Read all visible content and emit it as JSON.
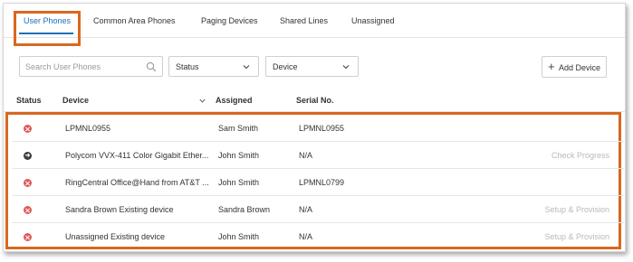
{
  "tabs": [
    {
      "label": "User Phones",
      "active": true
    },
    {
      "label": "Common Area Phones",
      "active": false
    },
    {
      "label": "Paging Devices",
      "active": false
    },
    {
      "label": "Shared Lines",
      "active": false
    },
    {
      "label": "Unassigned",
      "active": false
    }
  ],
  "toolbar": {
    "search_placeholder": "Search User Phones",
    "status_select": "Status",
    "device_select": "Device",
    "add_device_label": "Add Device"
  },
  "table": {
    "columns": [
      "Status",
      "Device",
      "Assigned",
      "Serial No."
    ],
    "rows": [
      {
        "status": "error",
        "device": "LPMNL0955",
        "assigned": "Sam Smith",
        "serial": "LPMNL0955",
        "action": ""
      },
      {
        "status": "in-progress",
        "device": "Polycom VVX-411 Color Gigabit Ether...",
        "assigned": "John Smith",
        "serial": "N/A",
        "action": "Check Progress"
      },
      {
        "status": "error",
        "device": "RingCentral Office@Hand from AT&T ...",
        "assigned": "John Smith",
        "serial": "LPMNL0799",
        "action": ""
      },
      {
        "status": "error",
        "device": "Sandra Brown Existing device",
        "assigned": "Sandra Brown",
        "serial": "N/A",
        "action": "Setup & Provision"
      },
      {
        "status": "error",
        "device": "Unassigned Existing device",
        "assigned": "John Smith",
        "serial": "N/A",
        "action": "Setup & Provision"
      }
    ]
  },
  "colors": {
    "accent": "#1e6fb6",
    "highlight": "#d9681f",
    "status_error": "#e05858",
    "status_progress": "#3c3c3c"
  }
}
